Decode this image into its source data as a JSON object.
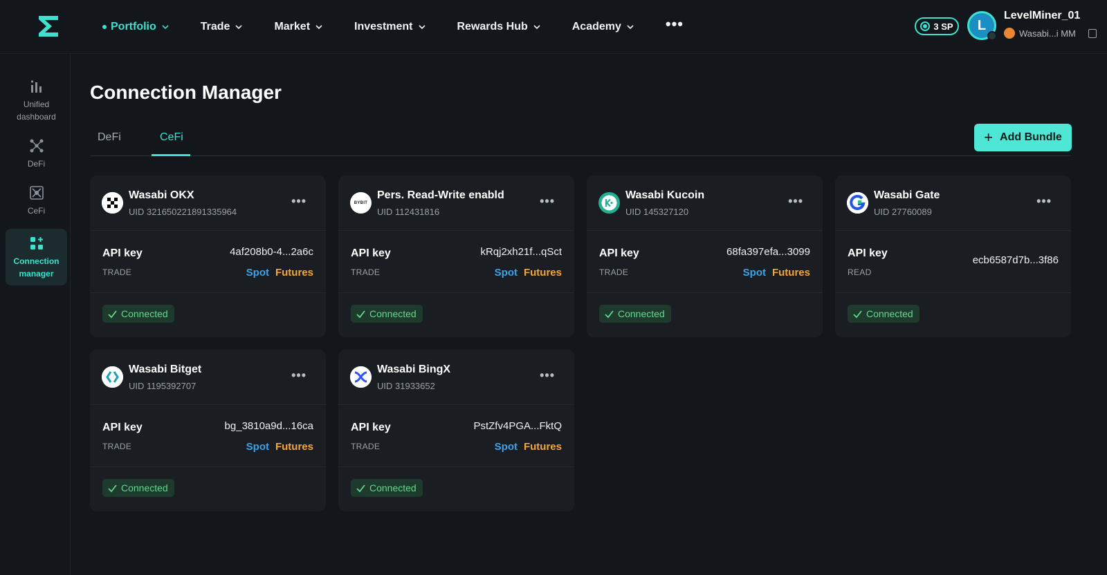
{
  "nav": {
    "items": [
      {
        "label": "Portfolio",
        "active": true
      },
      {
        "label": "Trade"
      },
      {
        "label": "Market"
      },
      {
        "label": "Investment"
      },
      {
        "label": "Rewards Hub"
      },
      {
        "label": "Academy"
      }
    ],
    "more": "•••"
  },
  "user": {
    "sp": "3 SP",
    "initial": "L",
    "name": "LevelMiner_01",
    "wallet": "Wasabi...i MM"
  },
  "sidebar": {
    "items": [
      {
        "label": "Unified dashboard",
        "icon": "bar-chart-icon"
      },
      {
        "label": "DeFi",
        "icon": "defi-icon"
      },
      {
        "label": "CeFi",
        "icon": "cefi-icon"
      },
      {
        "label": "Connection manager",
        "icon": "connection-icon",
        "active": true
      }
    ]
  },
  "page": {
    "title": "Connection Manager",
    "tabs": [
      {
        "label": "DeFi"
      },
      {
        "label": "CeFi",
        "active": true
      }
    ],
    "add_button": "Add Bundle"
  },
  "colors": {
    "accent": "#3fe0cf",
    "spot": "#3ba3e8",
    "futures": "#f3a73a",
    "connected": "#63d88e"
  },
  "cards": [
    {
      "name": "Wasabi OKX",
      "uid": "UID 321650221891335964",
      "api_label": "API key",
      "key": "4af208b0-4...2a6c",
      "perm": "TRADE",
      "spot": "Spot",
      "futures": "Futures",
      "status": "Connected",
      "exchange_icon": "okx-icon"
    },
    {
      "name": "Pers. Read-Write enabld",
      "uid": "UID 112431816",
      "api_label": "API key",
      "key": "kRqj2xh21f...qSct",
      "perm": "TRADE",
      "spot": "Spot",
      "futures": "Futures",
      "status": "Connected",
      "exchange_icon": "bybit-icon",
      "logo_text": "BYBIT"
    },
    {
      "name": "Wasabi Kucoin",
      "uid": "UID 145327120",
      "api_label": "API key",
      "key": "68fa397efa...3099",
      "perm": "TRADE",
      "spot": "Spot",
      "futures": "Futures",
      "status": "Connected",
      "exchange_icon": "kucoin-icon"
    },
    {
      "name": "Wasabi Gate",
      "uid": "UID 27760089",
      "api_label": "API key",
      "key": "ecb6587d7b...3f86",
      "perm": "READ",
      "status": "Connected",
      "exchange_icon": "gate-icon"
    },
    {
      "name": "Wasabi Bitget",
      "uid": "UID 1195392707",
      "api_label": "API key",
      "key": "bg_3810a9d...16ca",
      "perm": "TRADE",
      "spot": "Spot",
      "futures": "Futures",
      "status": "Connected",
      "exchange_icon": "bitget-icon"
    },
    {
      "name": "Wasabi BingX",
      "uid": "UID 31933652",
      "api_label": "API key",
      "key": "PstZfv4PGA...FktQ",
      "perm": "TRADE",
      "spot": "Spot",
      "futures": "Futures",
      "status": "Connected",
      "exchange_icon": "bingx-icon"
    }
  ]
}
